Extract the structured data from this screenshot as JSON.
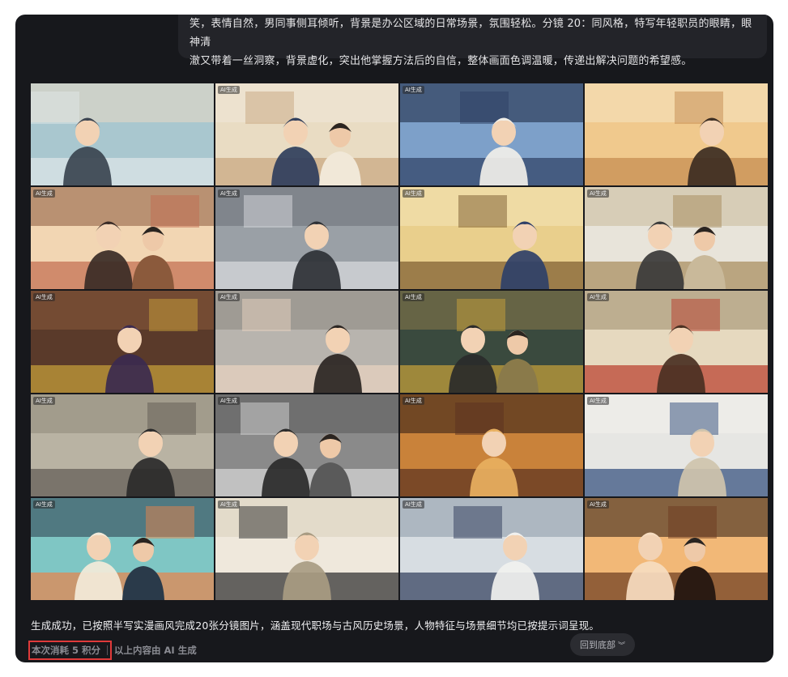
{
  "prompt_bubble": {
    "line1": "笑，表情自然，男同事侧耳倾听，背景是办公区域的日常场景，氛围轻松。分镜 20：同风格，特写年轻职员的眼睛，眼神清",
    "line2": "澈又带着一丝洞察，背景虚化，突出他掌握方法后的自信，整体画面色调温暖，传递出解决问题的希望感。"
  },
  "ai_tag": "AI生成",
  "images": [
    {
      "scene": "stressed-office-worker-at-computer",
      "palette": [
        "#a9c7cf",
        "#dfe7e8",
        "#3b4450",
        "#e9d8c4"
      ]
    },
    {
      "scene": "two-colleagues-in-office-kitchen",
      "palette": [
        "#e9dcc3",
        "#c7a57f",
        "#2f3e5c",
        "#f1e8d8"
      ]
    },
    {
      "scene": "man-in-suit-holding-paper-silhouette",
      "palette": [
        "#7da0c9",
        "#2d3f63",
        "#f1efe9",
        "#17233c"
      ]
    },
    {
      "scene": "couple-in-cafe",
      "palette": [
        "#f0c98d",
        "#c38a4f",
        "#3c2d22",
        "#f6e3c2"
      ]
    },
    {
      "scene": "two-women-chatting-in-cafe",
      "palette": [
        "#f2d6b3",
        "#c26b4f",
        "#3a2b26",
        "#8b5a3c"
      ]
    },
    {
      "scene": "man-looking-at-people-in-fog",
      "palette": [
        "#9aa0a6",
        "#dadcdf",
        "#2e3136",
        "#6b7077"
      ]
    },
    {
      "scene": "old-sage-reading-book",
      "palette": [
        "#e9cf8c",
        "#7a5a2e",
        "#2f4068",
        "#f4e5b8"
      ]
    },
    {
      "scene": "ancient-scholar-in-study",
      "palette": [
        "#e8e4da",
        "#a68a5a",
        "#3a3a3a",
        "#c9b99a"
      ]
    },
    {
      "scene": "ancient-court-scene",
      "palette": [
        "#5a3a2a",
        "#c9a23a",
        "#3b2a4f",
        "#8a5a3a"
      ]
    },
    {
      "scene": "young-man-surprised-closeup",
      "palette": [
        "#b8b4ae",
        "#e9d3c0",
        "#2a2522",
        "#8b8680"
      ]
    },
    {
      "scene": "emperor-on-throne",
      "palette": [
        "#3a4a3e",
        "#c9a23a",
        "#2a2a2a",
        "#8a7a4a"
      ]
    },
    {
      "scene": "general-on-horse-in-street",
      "palette": [
        "#e6d9bf",
        "#b83a2a",
        "#4a3022",
        "#9a8a6a"
      ]
    },
    {
      "scene": "officials-in-ancient-hall",
      "palette": [
        "#b9b3a3",
        "#5f5a52",
        "#2a2a2a",
        "#8f887a"
      ]
    },
    {
      "scene": "scholar-reading-scroll",
      "palette": [
        "#8a8a8a",
        "#d8d8d8",
        "#2a2a2a",
        "#5a5a5a"
      ]
    },
    {
      "scene": "ancient-advisor-with-lamp",
      "palette": [
        "#c9823a",
        "#5a3020",
        "#e8b060",
        "#2a1a12"
      ]
    },
    {
      "scene": "man-reading-book-on-sofa",
      "palette": [
        "#e6e6e3",
        "#2d4a7a",
        "#cfc4ad",
        "#f3f1ec"
      ]
    },
    {
      "scene": "office-worker-flexing-motivated",
      "palette": [
        "#7fc6c4",
        "#e9834a",
        "#f3ead9",
        "#2a3a4a"
      ]
    },
    {
      "scene": "calligraphy-title-scene",
      "palette": [
        "#efe8dc",
        "#2a2a2a",
        "#a89b82",
        "#d9cfbc"
      ]
    },
    {
      "scene": "two-colleagues-talking-at-desk",
      "palette": [
        "#d7dde2",
        "#2d3a5a",
        "#f1f1ef",
        "#8b98a6"
      ]
    },
    {
      "scene": "young-man-eye-closeup-warm",
      "palette": [
        "#f2b877",
        "#6b3a1f",
        "#f6dcc0",
        "#2a1a12"
      ]
    }
  ],
  "result_text": "生成成功，已按照半写实漫画风完成20张分镜图片，涵盖现代职场与古风历史场景，人物特征与场景细节均已按提示词呈现。",
  "footer": {
    "cost": "本次消耗 5 积分",
    "ai_note": "以上内容由 AI 生成"
  },
  "back_button": {
    "label": "回到底部",
    "icon": "double-chevron-down-icon"
  }
}
